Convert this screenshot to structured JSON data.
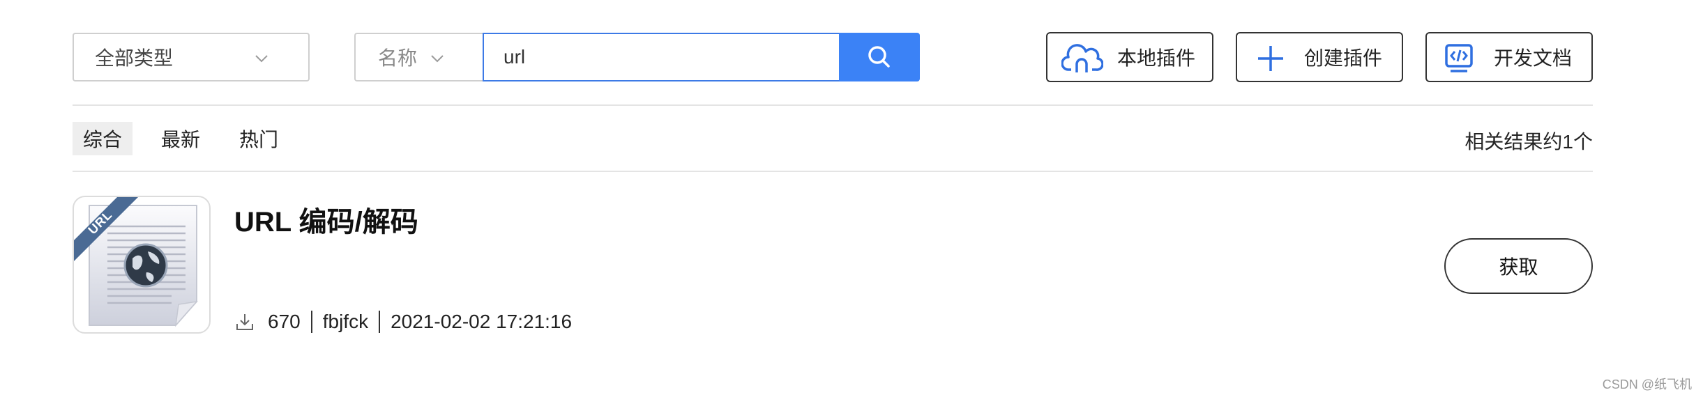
{
  "filters": {
    "type_select": "全部类型",
    "field_select": "名称"
  },
  "search": {
    "value": "url"
  },
  "toolbar": {
    "local_plugins": "本地插件",
    "create_plugin": "创建插件",
    "dev_docs": "开发文档"
  },
  "tabs": [
    {
      "label": "综合",
      "active": true
    },
    {
      "label": "最新",
      "active": false
    },
    {
      "label": "热门",
      "active": false
    }
  ],
  "result_count": "相关结果约1个",
  "results": [
    {
      "title": "URL 编码/解码",
      "downloads": "670",
      "author": "fbjfck",
      "date": "2021-02-02 17:21:16",
      "badge": "URL",
      "action_label": "获取"
    }
  ],
  "watermark": "CSDN @纸飞机",
  "colors": {
    "accent": "#3b82f6",
    "input_border": "#3d7ae6",
    "icon_blue": "#2f6fe0"
  }
}
